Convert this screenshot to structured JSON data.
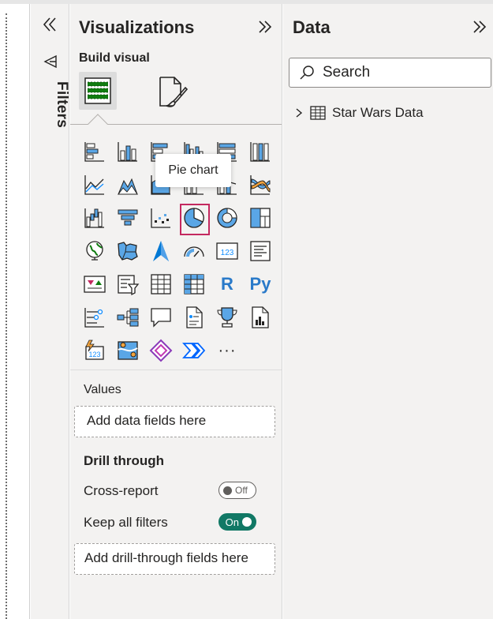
{
  "filters": {
    "label": "Filters"
  },
  "visualizations": {
    "title": "Visualizations",
    "build_visual_label": "Build visual",
    "tooltip": "Pie chart",
    "gallery": [
      "stacked-bar-chart-icon",
      "stacked-column-chart-icon",
      "clustered-bar-chart-icon",
      "clustered-column-chart-icon",
      "100-stacked-bar-chart-icon",
      "100-stacked-column-chart-icon",
      "line-chart-icon",
      "area-chart-icon",
      "stacked-area-chart-icon",
      "line-and-column-chart-icon",
      "line-and-clustered-column-chart-icon",
      "ribbon-chart-icon",
      "waterfall-chart-icon",
      "funnel-icon",
      "scatter-chart-icon",
      "pie-chart-icon",
      "donut-chart-icon",
      "treemap-icon",
      "map-icon",
      "filled-map-icon",
      "azure-map-icon",
      "gauge-icon",
      "card-icon",
      "multi-row-card-icon",
      "kpi-icon",
      "slicer-icon",
      "table-icon",
      "matrix-icon",
      "r-visual-icon",
      "python-visual-icon",
      "key-influencers-icon",
      "decomposition-tree-icon",
      "qa-icon",
      "smart-narrative-icon",
      "metrics-icon",
      "paginated-report-icon",
      "power-apps-icon",
      "arcgis-map-icon",
      "power-automate-icon",
      "power-automate-flow-icon",
      "more-visuals-icon"
    ],
    "r_label": "R",
    "py_label": "Py",
    "more_label": "···",
    "values_label": "Values",
    "values_placeholder": "Add data fields here",
    "drill_through_title": "Drill through",
    "cross_report_label": "Cross-report",
    "cross_report_toggle": "Off",
    "keep_filters_label": "Keep all filters",
    "keep_filters_toggle": "On",
    "drillthrough_placeholder": "Add drill-through fields here"
  },
  "data": {
    "title": "Data",
    "search_placeholder": "Search",
    "tables": [
      "Star Wars Data"
    ]
  },
  "colors": {
    "accent_blue": "#118dff",
    "pane_bg": "#f3f2f1",
    "toggle_on": "#117865",
    "selected_outline": "#c4285f"
  }
}
